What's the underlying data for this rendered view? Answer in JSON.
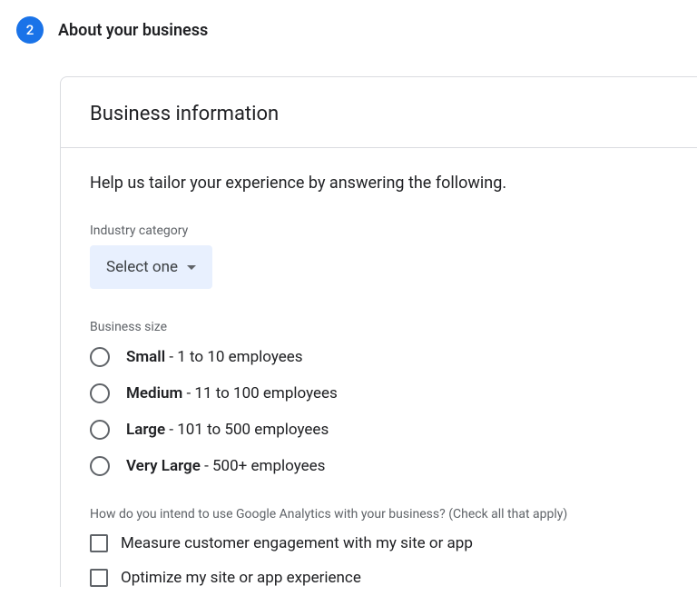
{
  "step": {
    "number": "2",
    "title": "About your business"
  },
  "card": {
    "title": "Business information",
    "helper": "Help us tailor your experience by answering the following."
  },
  "industry": {
    "label": "Industry category",
    "selected": "Select one"
  },
  "businessSize": {
    "label": "Business size",
    "options": [
      {
        "bold": "Small",
        "rest": " - 1 to 10 employees"
      },
      {
        "bold": "Medium",
        "rest": " - 11 to 100 employees"
      },
      {
        "bold": "Large",
        "rest": " - 101 to 500 employees"
      },
      {
        "bold": "Very Large",
        "rest": " - 500+ employees"
      }
    ]
  },
  "usage": {
    "label": "How do you intend to use Google Analytics with your business? (Check all that apply)",
    "options": [
      "Measure customer engagement with my site or app",
      "Optimize my site or app experience"
    ]
  }
}
